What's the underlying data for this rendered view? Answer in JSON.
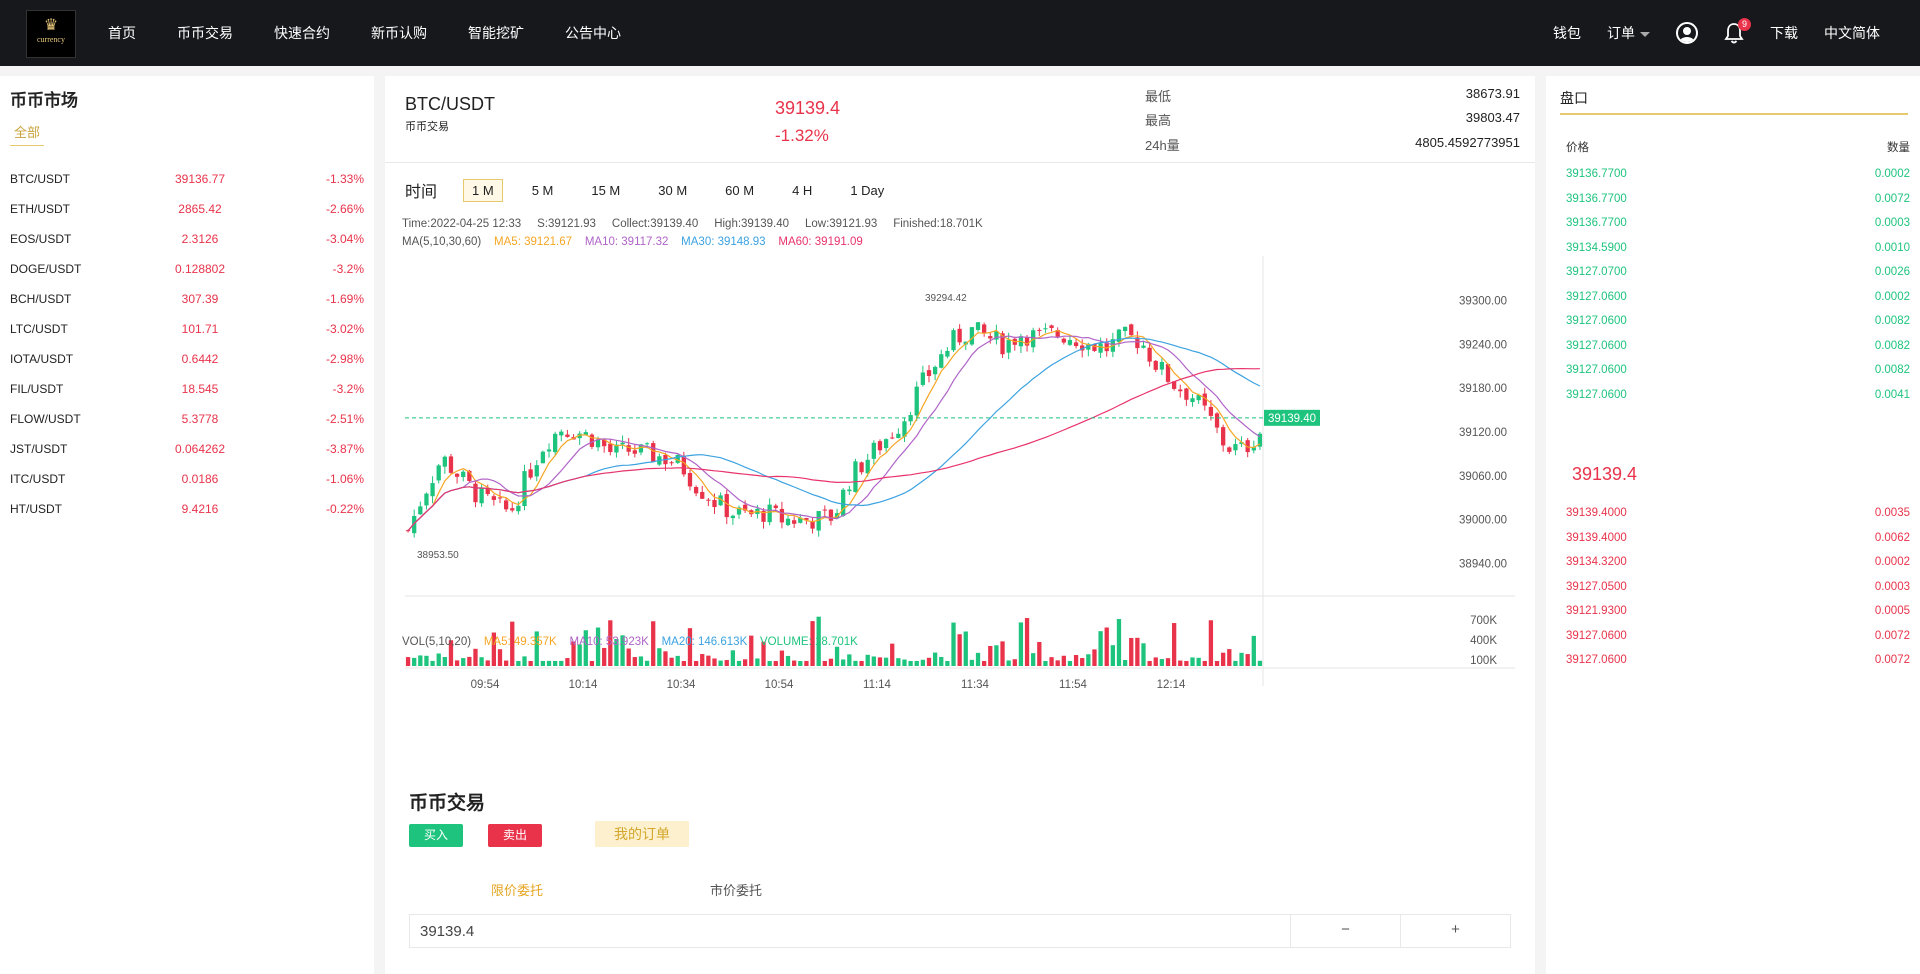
{
  "nav": {
    "logo_text": "currency",
    "items": [
      "首页",
      "币币交易",
      "快速合约",
      "新币认购",
      "智能挖矿",
      "公告中心"
    ],
    "wallet": "钱包",
    "orders": "订单",
    "notify_count": "9",
    "download": "下载",
    "language": "中文简体"
  },
  "market": {
    "title": "币币市场",
    "tab_all": "全部",
    "rows": [
      {
        "symbol": "BTC/USDT",
        "price": "39136.77",
        "change": "-1.33%"
      },
      {
        "symbol": "ETH/USDT",
        "price": "2865.42",
        "change": "-2.66%"
      },
      {
        "symbol": "EOS/USDT",
        "price": "2.3126",
        "change": "-3.04%"
      },
      {
        "symbol": "DOGE/USDT",
        "price": "0.128802",
        "change": "-3.2%"
      },
      {
        "symbol": "BCH/USDT",
        "price": "307.39",
        "change": "-1.69%"
      },
      {
        "symbol": "LTC/USDT",
        "price": "101.71",
        "change": "-3.02%"
      },
      {
        "symbol": "IOTA/USDT",
        "price": "0.6442",
        "change": "-2.98%"
      },
      {
        "symbol": "FIL/USDT",
        "price": "18.545",
        "change": "-3.2%"
      },
      {
        "symbol": "FLOW/USDT",
        "price": "5.3778",
        "change": "-2.51%"
      },
      {
        "symbol": "JST/USDT",
        "price": "0.064262",
        "change": "-3.87%"
      },
      {
        "symbol": "ITC/USDT",
        "price": "0.0186",
        "change": "-1.06%"
      },
      {
        "symbol": "HT/USDT",
        "price": "9.4216",
        "change": "-0.22%"
      }
    ]
  },
  "ticker": {
    "pair": "BTC/USDT",
    "sub": "币币交易",
    "last": "39139.4",
    "change": "-1.32%",
    "low_label": "最低",
    "low": "38673.91",
    "high_label": "最高",
    "high": "39803.47",
    "vol_label": "24h量",
    "vol": "4805.4592773951"
  },
  "timeframes": {
    "label": "时间",
    "items": [
      "1 M",
      "5 M",
      "15 M",
      "30 M",
      "60 M",
      "4 H",
      "1 Day"
    ],
    "active": "1 M"
  },
  "chart_info": {
    "line1": "Time:2022-04-25 12:33     S:39121.93     Collect:39139.40     High:39139.40     Low:39121.93     Finished:18.701K",
    "ma_label": "MA(5,10,30,60)",
    "ma5": "MA5: 39121.67",
    "ma10": "MA10: 39117.32",
    "ma30": "MA30: 39148.93",
    "ma60": "MA60: 39191.09",
    "vol_label": "VOL(5,10,20)",
    "vma5": "MA5: 49.357K",
    "vma10": "MA10: 53.923K",
    "vma20": "MA20: 146.613K",
    "volume": "VOLUME: 18.701K"
  },
  "chart_data": {
    "type": "candlestick",
    "title": "BTC/USDT",
    "price_ticks": [
      39300,
      39240,
      39180,
      39120,
      39060,
      39000,
      38940
    ],
    "ylim": [
      38920,
      39320
    ],
    "vol_ticks": [
      "700K",
      "400K",
      "100K"
    ],
    "x_ticks": [
      "09:54",
      "10:14",
      "10:34",
      "10:54",
      "11:14",
      "11:34",
      "11:54",
      "12:14"
    ],
    "last_price": "39139.40",
    "max_label": "39294.42",
    "min_label": "38953.50",
    "colors": {
      "up": "#1ec47e",
      "down": "#e8334a",
      "ma5": "#f5a623",
      "ma10": "#b064c8",
      "ma30": "#3ba2e0",
      "ma60": "#e8336c"
    },
    "ma_close_path": [
      38985,
      39040,
      39085,
      39060,
      39035,
      39020,
      39010,
      39060,
      39105,
      39125,
      39120,
      39110,
      39090,
      39095,
      39090,
      39085,
      39075,
      39045,
      39025,
      39010,
      39005,
      39010,
      39000,
      39000,
      39000,
      39005,
      39060,
      39085,
      39110,
      39135,
      39180,
      39215,
      39245,
      39260,
      39250,
      39240,
      39255,
      39250,
      39255,
      39250,
      39240,
      39235,
      39250,
      39245,
      39210,
      39185,
      39170,
      39140,
      39100,
      39095,
      39120
    ]
  },
  "trade": {
    "title": "币币交易",
    "buy": "买入",
    "sell": "卖出",
    "my_orders": "我的订单",
    "limit": "限价委托",
    "market": "市价委托",
    "price_value": "39139.4",
    "minus": "−",
    "plus": "+"
  },
  "orderbook": {
    "title": "盘口",
    "price_h": "价格",
    "qty_h": "数量",
    "bids": [
      {
        "p": "39136.7700",
        "q": "0.0002"
      },
      {
        "p": "39136.7700",
        "q": "0.0072"
      },
      {
        "p": "39136.7700",
        "q": "0.0003"
      },
      {
        "p": "39134.5900",
        "q": "0.0010"
      },
      {
        "p": "39127.0700",
        "q": "0.0026"
      },
      {
        "p": "39127.0600",
        "q": "0.0002"
      },
      {
        "p": "39127.0600",
        "q": "0.0082"
      },
      {
        "p": "39127.0600",
        "q": "0.0082"
      },
      {
        "p": "39127.0600",
        "q": "0.0082"
      },
      {
        "p": "39127.0600",
        "q": "0.0041"
      }
    ],
    "mid": "39139.4",
    "asks": [
      {
        "p": "39139.4000",
        "q": "0.0035"
      },
      {
        "p": "39139.4000",
        "q": "0.0062"
      },
      {
        "p": "39134.3200",
        "q": "0.0002"
      },
      {
        "p": "39127.0500",
        "q": "0.0003"
      },
      {
        "p": "39121.9300",
        "q": "0.0005"
      },
      {
        "p": "39127.0600",
        "q": "0.0072"
      },
      {
        "p": "39127.0600",
        "q": "0.0072"
      }
    ]
  }
}
